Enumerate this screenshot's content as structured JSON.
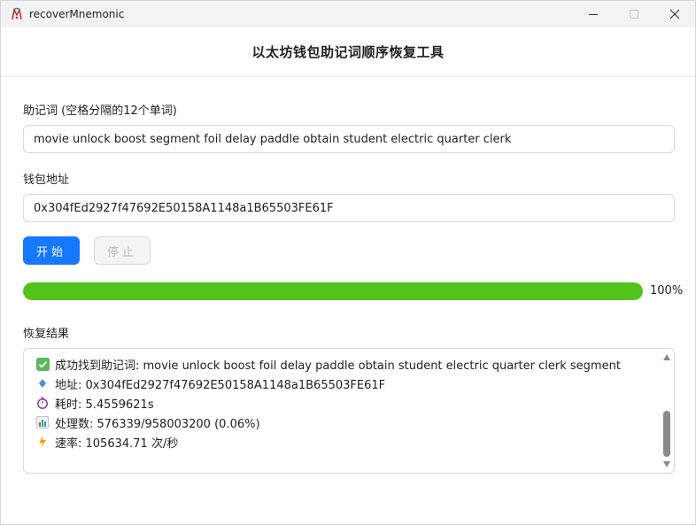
{
  "window": {
    "title": "recoverMnemonic",
    "icon": "app-logo-icon",
    "controls": [
      "minimize-icon",
      "maximize-icon",
      "close-icon"
    ]
  },
  "header": {
    "title": "以太坊钱包助记词顺序恢复工具"
  },
  "form": {
    "mnemonic_label": "助记词 (空格分隔的12个单词)",
    "mnemonic_value": "movie unlock boost segment foil delay paddle obtain student electric quarter clerk",
    "address_label": "钱包地址",
    "address_value": "0x304fEd2927f47692E50158A1148a1B65503FE61F"
  },
  "buttons": {
    "start_label": "开始",
    "stop_label": "停止"
  },
  "progress": {
    "percent": 100,
    "text": "100%",
    "color": "#52c41a"
  },
  "results": {
    "label": "恢复结果",
    "lines": [
      {
        "icon": "check-mark-icon",
        "text": "成功找到助记词: movie unlock boost foil delay paddle obtain student electric quarter clerk segment"
      },
      {
        "icon": "diamond-icon",
        "text": "地址: 0x304fEd2927f47692E50158A1148a1B65503FE61F"
      },
      {
        "icon": "stopwatch-icon",
        "text": "耗时: 5.4559621s"
      },
      {
        "icon": "bar-chart-icon",
        "text": "处理数: 576339/958003200 (0.06%)"
      },
      {
        "icon": "lightning-icon",
        "text": "速率: 105634.71 次/秒"
      }
    ]
  },
  "colors": {
    "primary": "#1677ff",
    "success": "#52c41a",
    "border": "#d9d9d9"
  }
}
